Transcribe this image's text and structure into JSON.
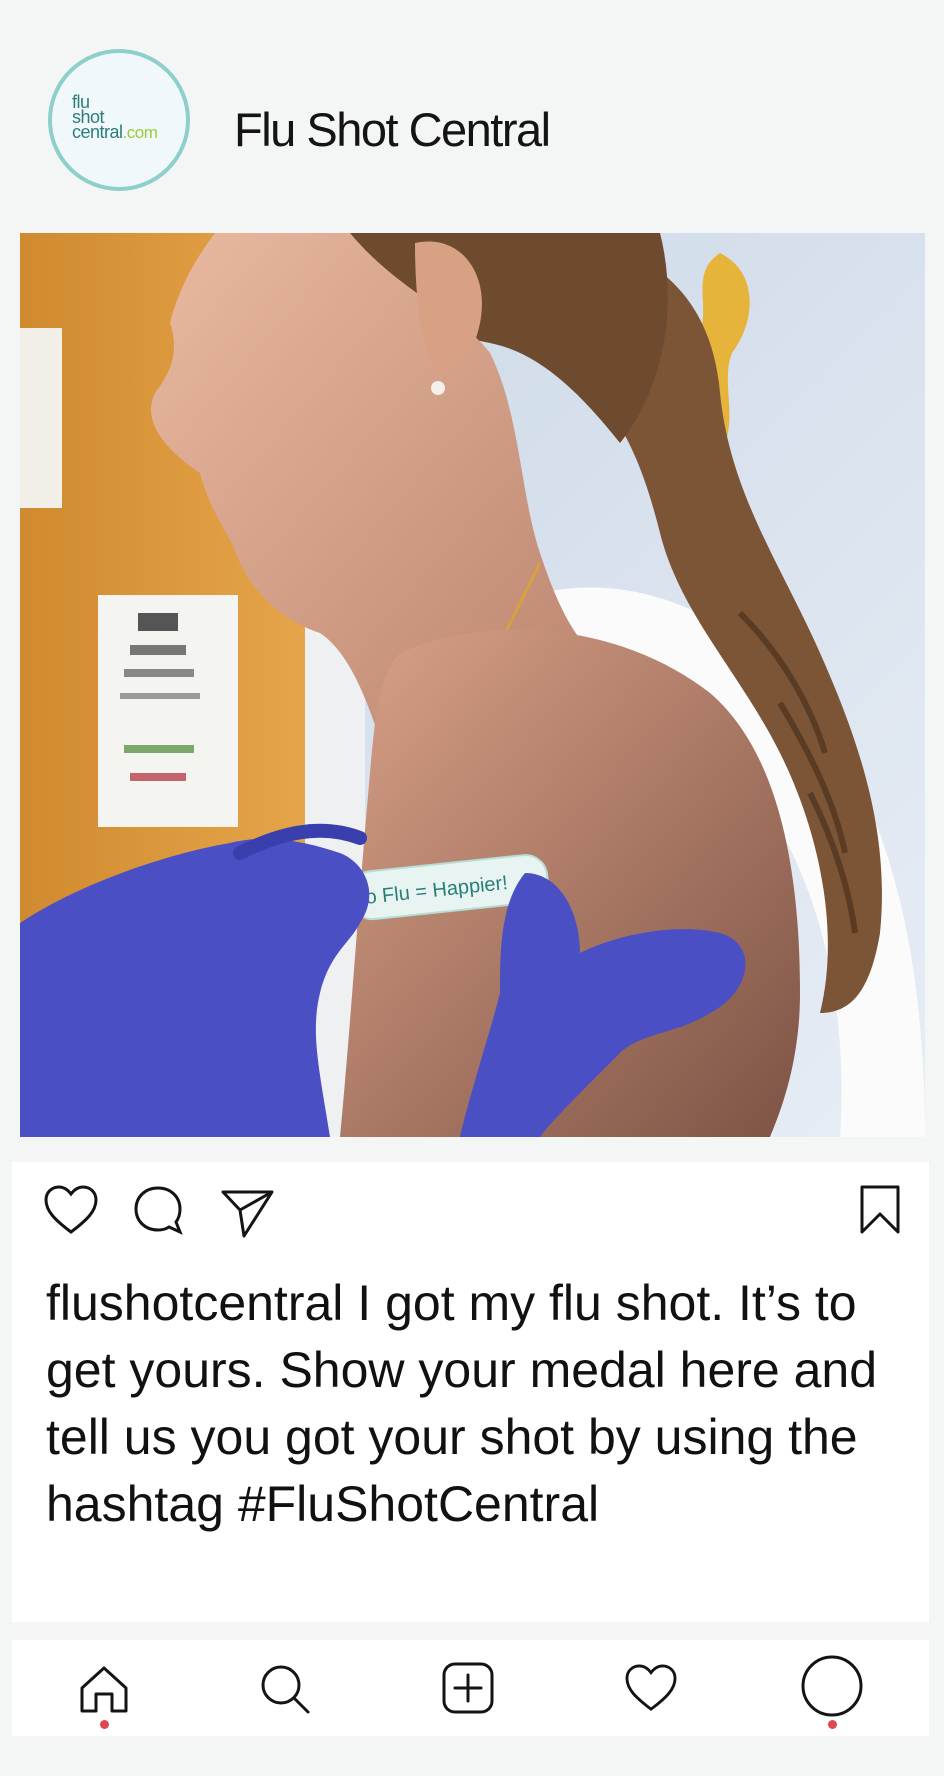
{
  "header": {
    "avatar_logo": {
      "line1": "flu",
      "line2": "shot",
      "line3": "central",
      "suffix": ".com"
    },
    "account_name": "Flu Shot Central"
  },
  "photo": {
    "bandage_text": "o Flu = Happier!"
  },
  "caption": {
    "username": "flushotcentral",
    "text": "I got my flu shot. It’s to get yours. Show your medal here and tell us you got your shot by using the hashtag #FluShotCentral"
  },
  "colors": {
    "avatar_ring": "#8fcfcb",
    "logo_teal": "#2a7e78",
    "logo_green": "#9ccb3b",
    "notification_dot": "#e0474c",
    "glove_blue": "#4a4fc4"
  },
  "icons": {
    "actions": [
      "heart-icon",
      "comment-icon",
      "send-icon",
      "bookmark-icon"
    ],
    "nav": [
      "home-icon",
      "search-icon",
      "add-icon",
      "activity-icon",
      "profile-icon"
    ]
  }
}
